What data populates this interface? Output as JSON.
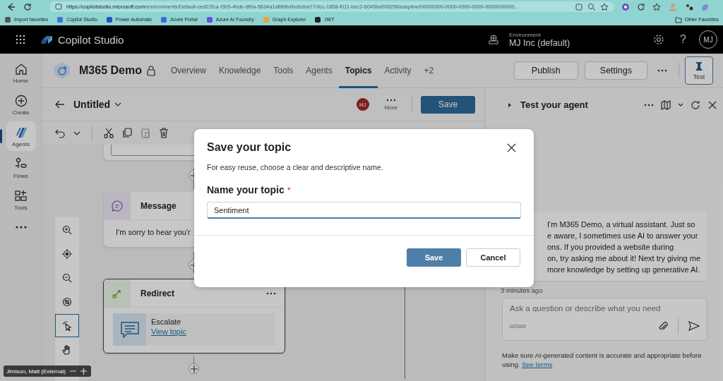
{
  "browser": {
    "url": "https://copilotstudio.microsoft.com/environments/Default-ced22fca-f3b5-4bde-8f0a-5634a1d8f66d/bots/ba77cfcc-1858-f011-bec2-6045bd00625f/adaptive/00000000-0000-0000-0000-0000000000...",
    "bookmarks": [
      "Import favorites",
      "Copilot Studio",
      "Power Automate",
      "Azure Portal",
      "Azure AI Foundry",
      "Graph Explorer",
      "JWT"
    ],
    "other_favorites": "Other Favorites"
  },
  "app": {
    "name": "Copilot Studio",
    "environment_label": "Environment",
    "environment": "MJ Inc (default)",
    "help": "?",
    "avatar": "MJ"
  },
  "rail": [
    {
      "label": "Home",
      "selected": false
    },
    {
      "label": "Create",
      "selected": false
    },
    {
      "label": "Agents",
      "selected": true
    },
    {
      "label": "Flows",
      "selected": false
    },
    {
      "label": "Tools",
      "selected": false
    }
  ],
  "agent": {
    "name": "M365 Demo"
  },
  "tabs": [
    {
      "label": "Overview",
      "selected": false
    },
    {
      "label": "Knowledge",
      "selected": false
    },
    {
      "label": "Tools",
      "selected": false
    },
    {
      "label": "Agents",
      "selected": false
    },
    {
      "label": "Topics",
      "selected": true
    },
    {
      "label": "Activity",
      "selected": false
    },
    {
      "label": "+2",
      "selected": false
    }
  ],
  "actions": [
    "Publish",
    "Settings"
  ],
  "test_button": "Test",
  "topic": {
    "title": "Untitled",
    "user_avatar": "MJ",
    "more_label": "More",
    "save_label": "Save"
  },
  "canvas": {
    "nodes": [
      {
        "kind": "message",
        "title": "Message",
        "text": "I'm sorry to hear you'r"
      },
      {
        "kind": "redirect",
        "title": "Redirect",
        "target": "Escalate",
        "link": "View topic"
      }
    ]
  },
  "test_panel": {
    "title": "Test your agent",
    "message_lines": [
      "I'm M365 Demo, a virtual assistant. Just so",
      "e aware, I sometimes use AI to answer your",
      "ons. If you provided a website during",
      "on, try asking me about it! Next try giving me",
      "more knowledge by setting up generative AI."
    ],
    "timestamp": "3 minutes ago",
    "input": {
      "placeholder": "Ask a question or describe what you need",
      "counter": "0/2000"
    },
    "disclaimer": "Make sure AI-generated content is accurate and appropriate before using.",
    "terms_link": "See terms"
  },
  "dialog": {
    "title": "Save your topic",
    "description": "For easy reuse, choose a clear and descriptive name.",
    "field_label": "Name your topic",
    "required_mark": "*",
    "field_value": "Sentiment",
    "buttons": [
      {
        "label": "Save",
        "kind": "primary"
      },
      {
        "label": "Cancel",
        "kind": "secondary"
      }
    ]
  },
  "presenter_badge": "Jimison, Matt (External)"
}
